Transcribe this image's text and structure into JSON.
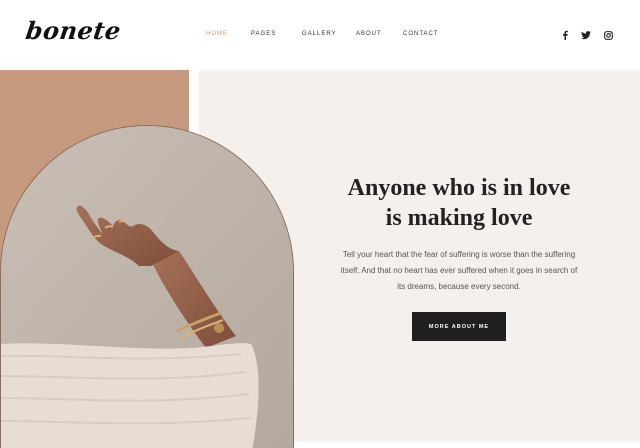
{
  "header": {
    "logo": "bonete",
    "nav": [
      {
        "label": "HOME",
        "active": true
      },
      {
        "label": "PAGES",
        "active": false
      },
      {
        "label": "GALLERY",
        "active": false
      },
      {
        "label": "ABOUT",
        "active": false
      },
      {
        "label": "CONTACT",
        "active": false
      }
    ],
    "social": [
      "facebook-icon",
      "twitter-icon",
      "instagram-icon"
    ]
  },
  "hero": {
    "title_line1": "Anyone who is in love",
    "title_line2": "is making love",
    "text_line1": "Tell your heart that the fear of suffering is worse than the suffering",
    "text_line2": "itself. And that no heart has ever suffered when it goes in search of",
    "text_line3": "its dreams, because every second.",
    "button": "MORE ABOUT ME"
  },
  "colors": {
    "accent": "#c4987b",
    "tan": "#c69a7e",
    "cream": "#f5f0eb",
    "button": "#1f1f1f"
  }
}
